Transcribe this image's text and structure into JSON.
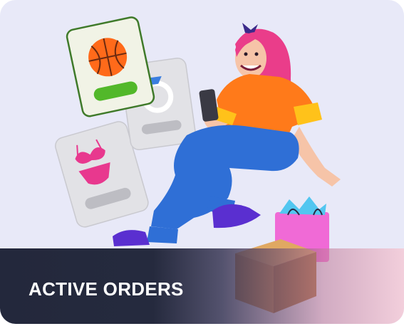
{
  "card": {
    "title": "ACTIVE ORDERS"
  },
  "colors": {
    "card_background": "#e8e9f8",
    "banner_dark": "#1f2438",
    "title_text": "#ffffff",
    "product_card_border_green": "#3f7a2a",
    "buy_button_green": "#52b82a",
    "shirt_orange": "#ff7a1a",
    "pants_blue": "#2f6fd6",
    "hair_pink": "#ea3d8a",
    "shopping_bag_pink": "#f06ad6",
    "parcel_brown": "#c88a4a"
  },
  "icons": {
    "basketball": "basketball-icon",
    "ring": "ring-icon",
    "bikini": "bikini-icon",
    "phone": "phone-icon",
    "shopping_bag": "shopping-bag-icon",
    "parcel": "parcel-box-icon"
  }
}
